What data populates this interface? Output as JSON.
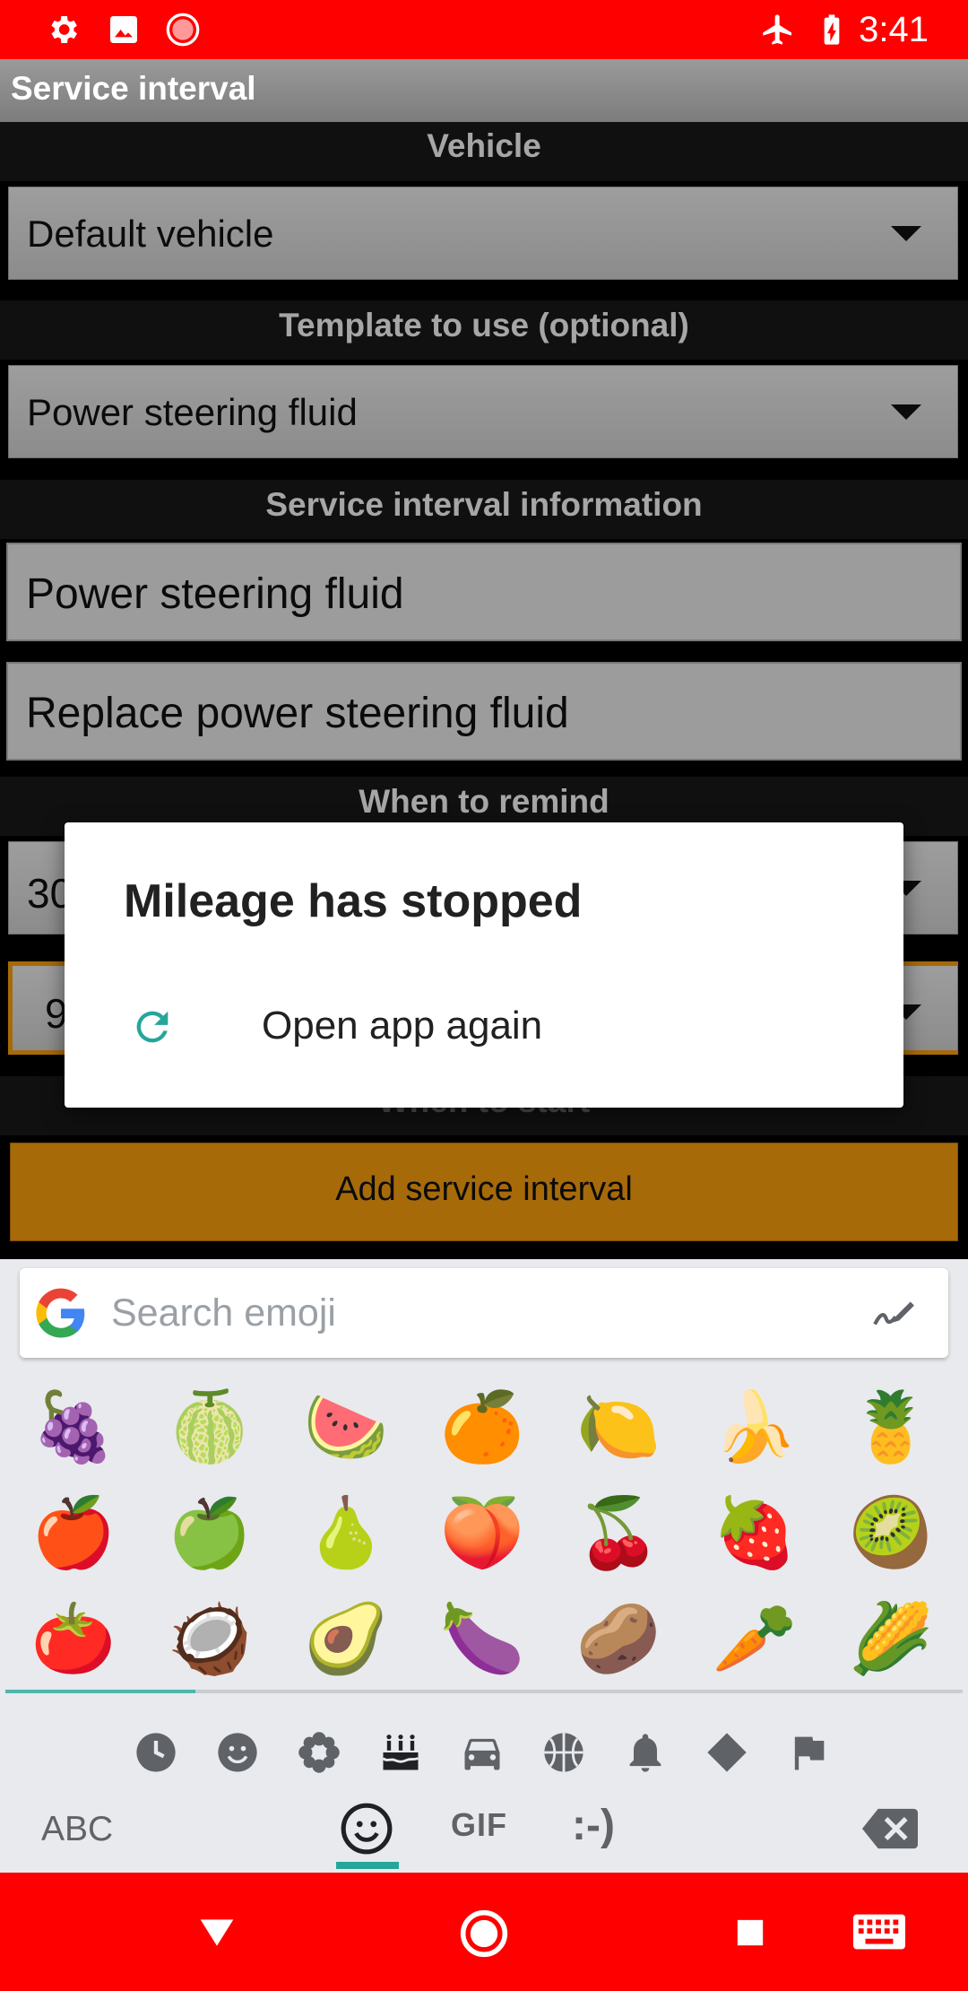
{
  "status_bar": {
    "time": "3:41",
    "left_icons": [
      "gear-icon",
      "image-icon",
      "record-icon"
    ],
    "right_icons": [
      "airplane-icon",
      "battery-charging-icon"
    ],
    "color": "#ff0000"
  },
  "toolbar": {
    "title": "Service interval"
  },
  "form": {
    "vehicle_header": "Vehicle",
    "vehicle_value": "Default vehicle",
    "template_header": "Template to use (optional)",
    "template_value": "Power steering fluid",
    "info_header": "Service interval information",
    "name_value": "Power steering fluid",
    "description_value": "Replace power steering fluid",
    "remind_header": "When to remind",
    "remind_distance_partial": "30",
    "remind_time_partial": "9",
    "start_header_partial": "When to start",
    "add_button": "Add service interval",
    "accent_color": "#ffa30f"
  },
  "dialog": {
    "title": "Mileage has stopped",
    "option_label": "Open app again",
    "option_icon": "refresh-icon",
    "icon_color": "#26a69a"
  },
  "keyboard": {
    "search_placeholder": "Search emoji",
    "emojis": [
      [
        "🍇",
        "🍈",
        "🍉",
        "🍊",
        "🍋",
        "🍌",
        "🍍"
      ],
      [
        "🍎",
        "🍏",
        "🍐",
        "🍑",
        "🍒",
        "🍓",
        "🥝"
      ],
      [
        "🍅",
        "🥥",
        "🥑",
        "🍆",
        "🥔",
        "🥕",
        "🌽"
      ]
    ],
    "categories": [
      "clock-icon",
      "smiley-icon",
      "flower-icon",
      "cake-icon",
      "car-icon",
      "ball-icon",
      "bell-icon",
      "diamond-icon",
      "flag-icon"
    ],
    "abc_label": "ABC",
    "gif_label": "GIF",
    "emoticon_label": ":-)"
  },
  "nav_bar": {
    "icons": [
      "back-triangle-icon",
      "home-circle-icon",
      "recents-square-icon",
      "keyboard-icon"
    ]
  }
}
